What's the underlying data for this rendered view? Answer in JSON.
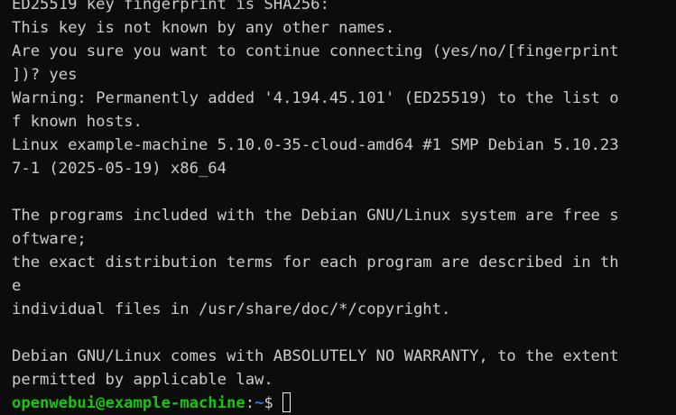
{
  "terminal": {
    "lines": [
      "ED25519 key fingerprint is SHA256:",
      "This key is not known by any other names.",
      "Are you sure you want to continue connecting (yes/no/[fingerprint",
      "])? yes",
      "Warning: Permanently added '4.194.45.101' (ED25519) to the list o",
      "f known hosts.",
      "Linux example-machine 5.10.0-35-cloud-amd64 #1 SMP Debian 5.10.23",
      "7-1 (2025-05-19) x86_64",
      "",
      "The programs included with the Debian GNU/Linux system are free s",
      "oftware;",
      "the exact distribution terms for each program are described in th",
      "e",
      "individual files in /usr/share/doc/*/copyright.",
      "",
      "Debian GNU/Linux comes with ABSOLUTELY NO WARRANTY, to the extent",
      "permitted by applicable law."
    ],
    "prompt": {
      "user_host": "openwebui@example-machine",
      "separator": ":",
      "path": "~",
      "symbol": "$"
    },
    "colors": {
      "background": "#0c0c0c",
      "text": "#cccccc",
      "user_host": "#16c60c",
      "path": "#3b78ff"
    }
  }
}
